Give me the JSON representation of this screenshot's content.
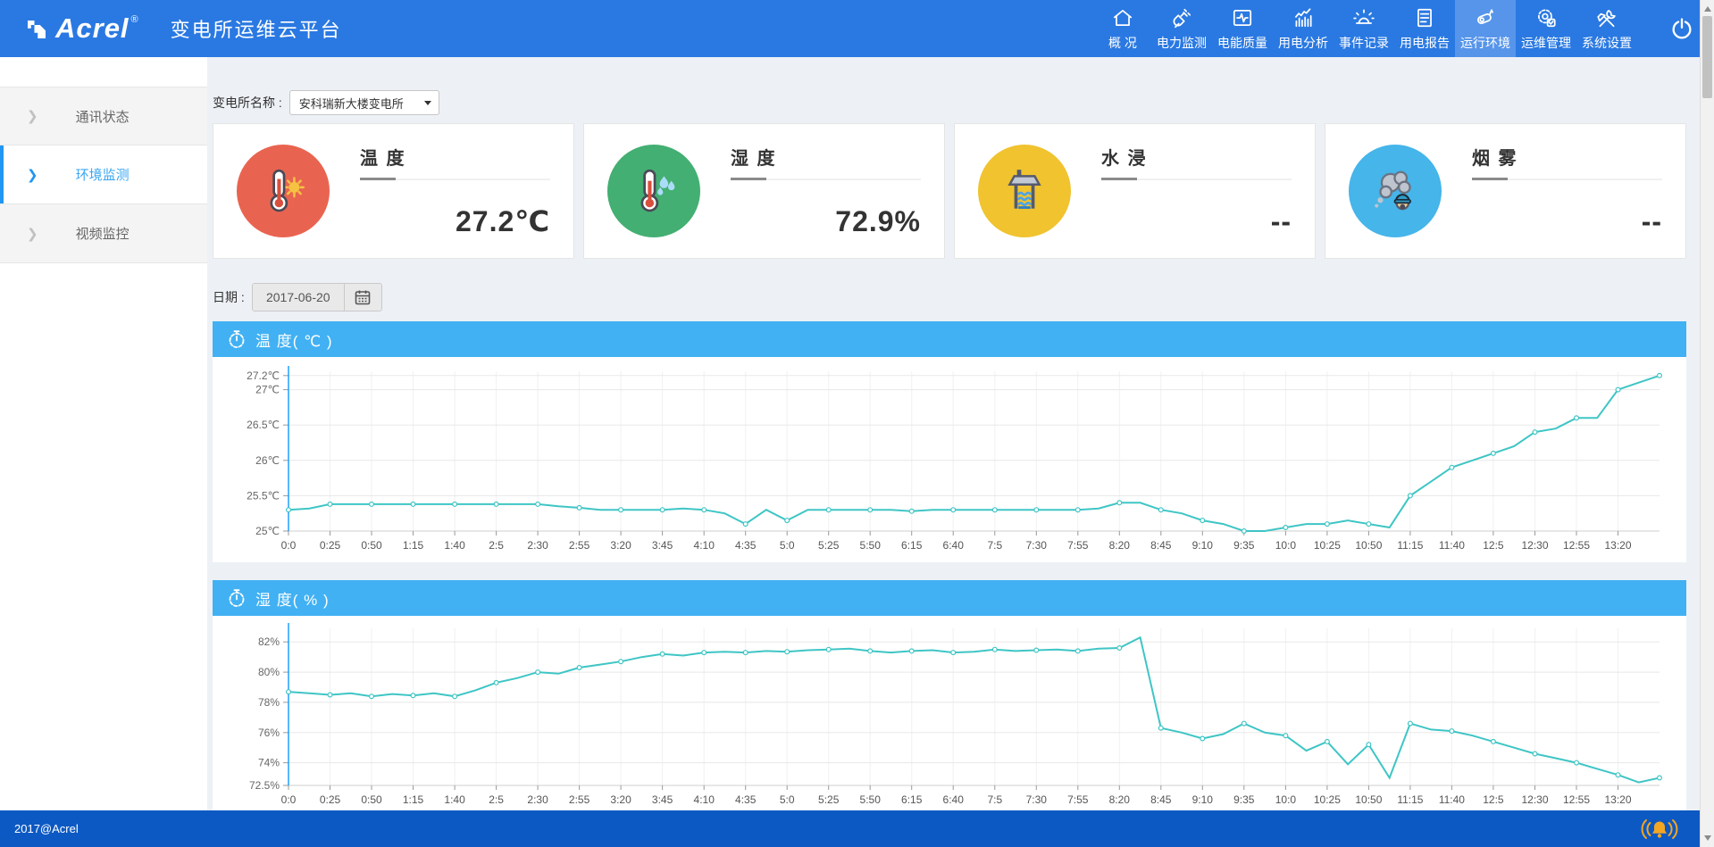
{
  "header": {
    "logo_text": "Acrel",
    "logo_reg": "®",
    "app_title": "变电所运维云平台",
    "nav": [
      {
        "label": "概 况",
        "icon": "home-icon",
        "active": false
      },
      {
        "label": "电力监测",
        "icon": "plug-icon",
        "active": false
      },
      {
        "label": "电能质量",
        "icon": "power-quality-icon",
        "active": false
      },
      {
        "label": "用电分析",
        "icon": "bar-chart-icon",
        "active": false
      },
      {
        "label": "事件记录",
        "icon": "alarm-icon",
        "active": false
      },
      {
        "label": "用电报告",
        "icon": "report-icon",
        "active": false
      },
      {
        "label": "运行环境",
        "icon": "camera-icon",
        "active": true
      },
      {
        "label": "运维管理",
        "icon": "gear-icon",
        "active": false
      },
      {
        "label": "系统设置",
        "icon": "tools-icon",
        "active": false
      }
    ]
  },
  "sidebar": {
    "items": [
      {
        "label": "通讯状态",
        "active": false
      },
      {
        "label": "环境监测",
        "active": true
      },
      {
        "label": "视频监控",
        "active": false
      }
    ]
  },
  "filters": {
    "station_label": "变电所名称 :",
    "station_value": "安科瑞新大楼变电所",
    "date_label": "日期 :",
    "date_value": "2017-06-20"
  },
  "cards": [
    {
      "title": "温 度",
      "value": "27.2℃",
      "icon": "thermometer-sun-icon",
      "circle_color": "#e96450"
    },
    {
      "title": "湿 度",
      "value": "72.9%",
      "icon": "thermometer-drops-icon",
      "circle_color": "#43af72"
    },
    {
      "title": "水 浸",
      "value": "--",
      "icon": "water-well-icon",
      "circle_color": "#f0c32f"
    },
    {
      "title": "烟 雾",
      "value": "--",
      "icon": "smoke-icon",
      "circle_color": "#45b5ea"
    }
  ],
  "chart_data": [
    {
      "type": "line",
      "name": "temperature-chart",
      "title": "温 度( ℃ )",
      "ylabel": "℃",
      "line_color": "#3fc5c5",
      "grid": true,
      "legend_position": "none",
      "y_render_min": 25,
      "y_render_max": 27.26,
      "y_ticks": [
        {
          "v": 25,
          "l": "25℃"
        },
        {
          "v": 25.5,
          "l": "25.5℃"
        },
        {
          "v": 26,
          "l": "26℃"
        },
        {
          "v": 26.5,
          "l": "26.5℃"
        },
        {
          "v": 27,
          "l": "27℃"
        },
        {
          "v": 27.2,
          "l": "27.2℃"
        }
      ],
      "x_labels": [
        "0:0",
        "0:25",
        "0:50",
        "1:15",
        "1:40",
        "2:5",
        "2:30",
        "2:55",
        "3:20",
        "3:45",
        "4:10",
        "4:35",
        "5:0",
        "5:25",
        "5:50",
        "6:15",
        "6:40",
        "7:5",
        "7:30",
        "7:55",
        "8:20",
        "8:45",
        "9:10",
        "9:35",
        "10:0",
        "10:25",
        "10:50",
        "11:15",
        "11:40",
        "12:5",
        "12:30",
        "12:55",
        "13:20"
      ],
      "values": [
        25.3,
        25.32,
        25.38,
        25.38,
        25.38,
        25.38,
        25.38,
        25.38,
        25.38,
        25.38,
        25.38,
        25.38,
        25.38,
        25.35,
        25.33,
        25.3,
        25.3,
        25.3,
        25.3,
        25.32,
        25.3,
        25.25,
        25.1,
        25.3,
        25.15,
        25.3,
        25.3,
        25.3,
        25.3,
        25.3,
        25.28,
        25.3,
        25.3,
        25.3,
        25.3,
        25.3,
        25.3,
        25.3,
        25.3,
        25.32,
        25.4,
        25.4,
        25.3,
        25.25,
        25.15,
        25.1,
        25.0,
        25.0,
        25.05,
        25.1,
        25.1,
        25.15,
        25.1,
        25.05,
        25.5,
        25.7,
        25.9,
        26.0,
        26.1,
        26.2,
        26.4,
        26.45,
        26.6,
        26.6,
        27.0,
        27.1,
        27.2
      ]
    },
    {
      "type": "line",
      "name": "humidity-chart",
      "title": "湿 度( % )",
      "ylabel": "%",
      "line_color": "#3fc5c5",
      "grid": true,
      "legend_position": "none",
      "y_render_min": 72.5,
      "y_render_max": 82.9,
      "y_ticks": [
        {
          "v": 72.5,
          "l": "72.5%"
        },
        {
          "v": 74,
          "l": "74%"
        },
        {
          "v": 76,
          "l": "76%"
        },
        {
          "v": 78,
          "l": "78%"
        },
        {
          "v": 80,
          "l": "80%"
        },
        {
          "v": 82,
          "l": "82%"
        }
      ],
      "x_labels": [
        "0:0",
        "0:25",
        "0:50",
        "1:15",
        "1:40",
        "2:5",
        "2:30",
        "2:55",
        "3:20",
        "3:45",
        "4:10",
        "4:35",
        "5:0",
        "5:25",
        "5:50",
        "6:15",
        "6:40",
        "7:5",
        "7:30",
        "7:55",
        "8:20",
        "8:45",
        "9:10",
        "9:35",
        "10:0",
        "10:25",
        "10:50",
        "11:15",
        "11:40",
        "12:5",
        "12:30",
        "12:55",
        "13:20"
      ],
      "values": [
        78.7,
        78.6,
        78.5,
        78.6,
        78.4,
        78.55,
        78.45,
        78.6,
        78.4,
        78.8,
        79.3,
        79.6,
        80.0,
        79.9,
        80.3,
        80.5,
        80.7,
        81.0,
        81.2,
        81.1,
        81.3,
        81.35,
        81.3,
        81.4,
        81.35,
        81.45,
        81.5,
        81.55,
        81.4,
        81.3,
        81.4,
        81.45,
        81.3,
        81.35,
        81.5,
        81.4,
        81.45,
        81.5,
        81.4,
        81.55,
        81.6,
        82.3,
        76.3,
        76.0,
        75.6,
        75.9,
        76.6,
        76.0,
        75.8,
        74.8,
        75.4,
        73.9,
        75.2,
        73.0,
        76.6,
        76.2,
        76.1,
        75.8,
        75.4,
        75.0,
        74.6,
        74.3,
        74.0,
        73.6,
        73.2,
        72.7,
        73.0
      ]
    }
  ],
  "footer": {
    "text": "2017@Acrel"
  },
  "colors": {
    "header_blue": "#2a79e2",
    "nav_active": "#5795ea",
    "panel_header_blue": "#41b1f3",
    "footer_blue": "#0d59c3",
    "line_teal": "#3fc5c5",
    "sidebar_active": "#2196f3",
    "bell_orange": "#f5a623"
  }
}
